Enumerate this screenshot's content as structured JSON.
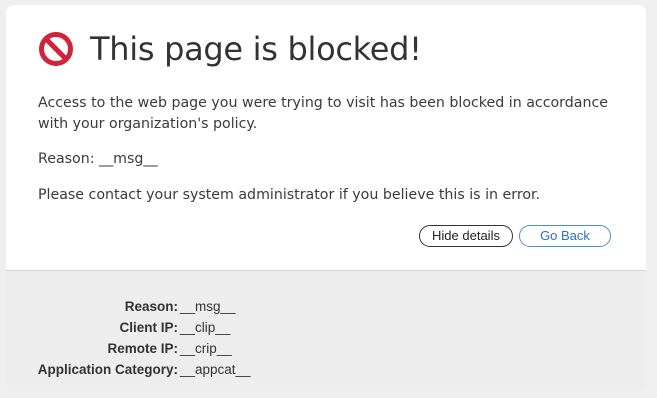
{
  "icon": "block-icon",
  "title": "This page is blocked!",
  "message": "Access to the web page you were trying to visit has been blocked in accordance with your organization's policy.",
  "reason_line": "Reason: __msg__",
  "contact": "Please contact your system administrator if you believe this is in error.",
  "buttons": {
    "hide_details": "Hide details",
    "go_back": "Go Back"
  },
  "details": [
    {
      "label": "Reason:",
      "value": "__msg__"
    },
    {
      "label": "Client IP:",
      "value": "__clip__"
    },
    {
      "label": "Remote IP:",
      "value": "__crip__"
    },
    {
      "label": "Application Category:",
      "value": "__appcat__"
    }
  ],
  "colors": {
    "block_icon": "#d0243a",
    "go_back": "#2a6fc4"
  }
}
